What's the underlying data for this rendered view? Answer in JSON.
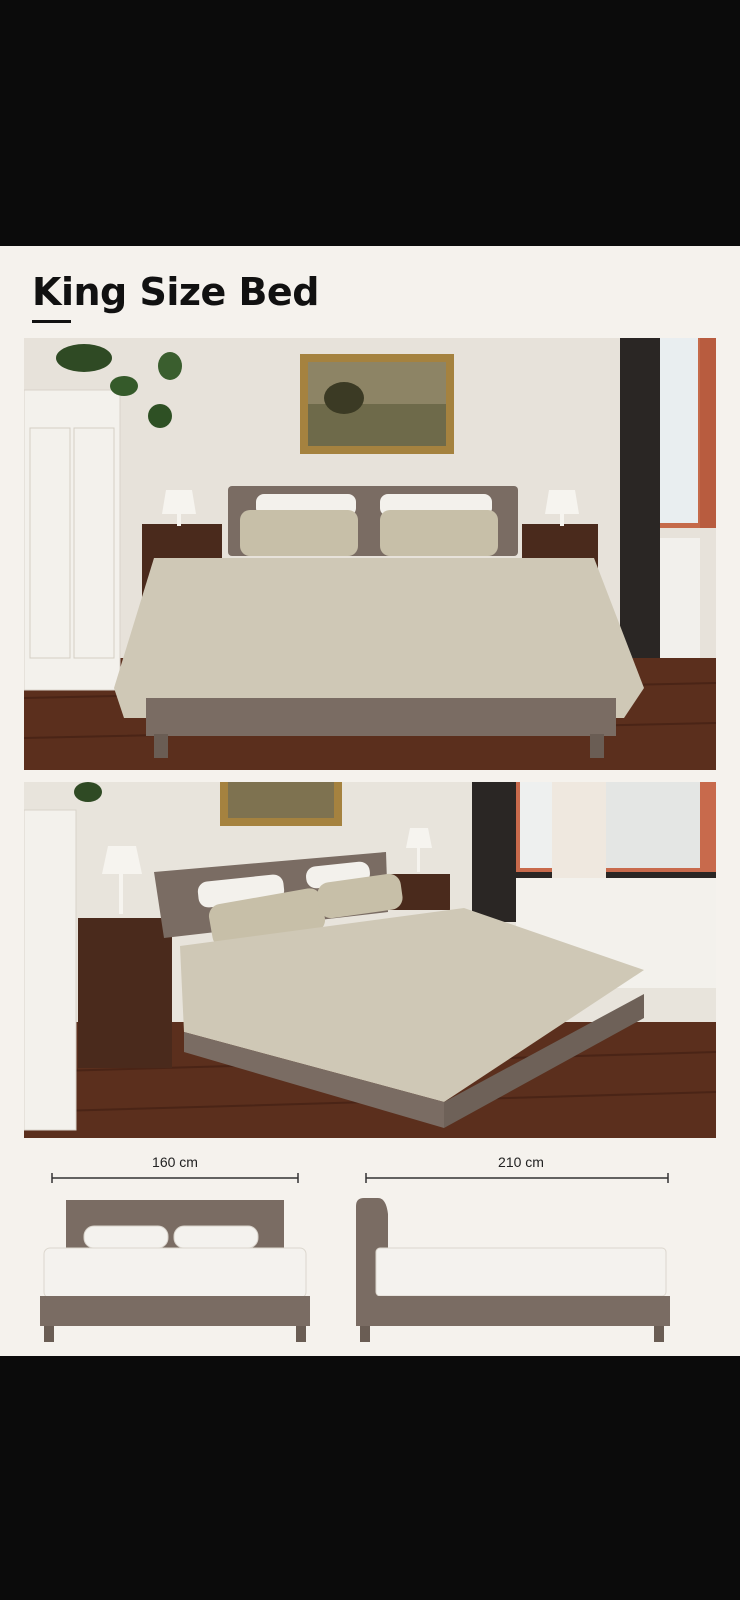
{
  "page": {
    "title": "King Size Bed"
  },
  "photos": [
    {
      "name": "front view bedroom photo"
    },
    {
      "name": "angled view bedroom photo"
    }
  ],
  "dimensions": {
    "width_label": "160 cm",
    "length_label": "210 cm"
  },
  "colors": {
    "background": "#0b0b0b",
    "card": "#f5f2ed",
    "bed_frame": "#7a6c63",
    "duvet": "#cdc6b3",
    "floor": "#5a2e1c",
    "wall": "#e6e1d9",
    "nightstand": "#4a2a1c"
  },
  "icons": [
    "dimension-arrow-icon"
  ]
}
